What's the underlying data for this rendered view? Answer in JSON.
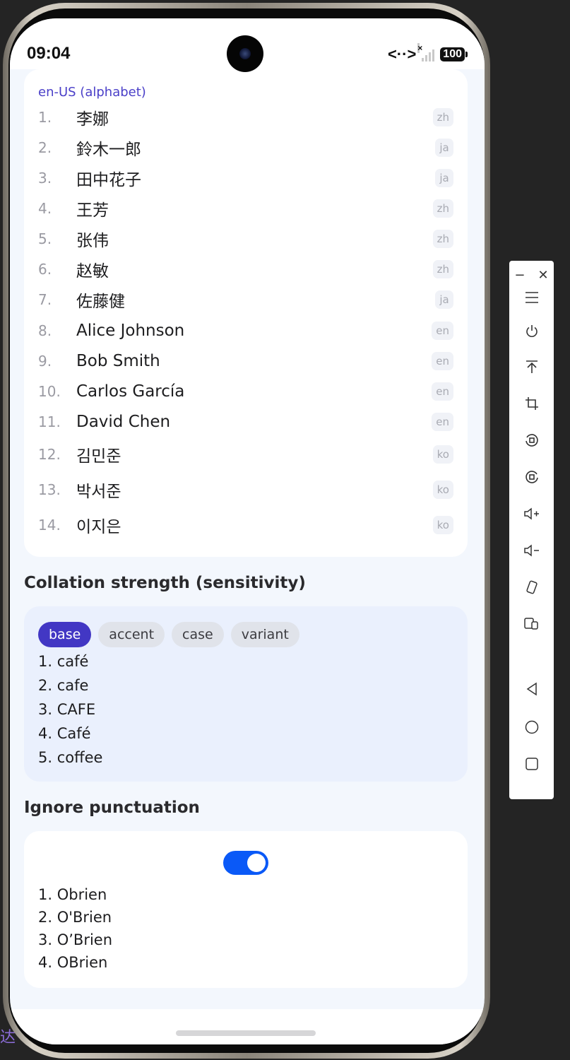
{
  "status_bar": {
    "time": "09:04",
    "battery": "100"
  },
  "sorted_list": {
    "caption": "en-US (alphabet)",
    "rows": [
      {
        "num": "1.",
        "name": "李娜",
        "lang": "zh"
      },
      {
        "num": "2.",
        "name": "鈴木一郎",
        "lang": "ja"
      },
      {
        "num": "3.",
        "name": "田中花子",
        "lang": "ja"
      },
      {
        "num": "4.",
        "name": "王芳",
        "lang": "zh"
      },
      {
        "num": "5.",
        "name": "张伟",
        "lang": "zh"
      },
      {
        "num": "6.",
        "name": "赵敏",
        "lang": "zh"
      },
      {
        "num": "7.",
        "name": "佐藤健",
        "lang": "ja"
      },
      {
        "num": "8.",
        "name": "Alice Johnson",
        "lang": "en"
      },
      {
        "num": "9.",
        "name": "Bob Smith",
        "lang": "en"
      },
      {
        "num": "10.",
        "name": "Carlos García",
        "lang": "en"
      },
      {
        "num": "11.",
        "name": "David Chen",
        "lang": "en"
      },
      {
        "num": "12.",
        "name": "김민준",
        "lang": "ko"
      },
      {
        "num": "13.",
        "name": "박서준",
        "lang": "ko"
      },
      {
        "num": "14.",
        "name": "이지은",
        "lang": "ko"
      }
    ]
  },
  "strength": {
    "heading": "Collation strength (sensitivity)",
    "chips": [
      "base",
      "accent",
      "case",
      "variant"
    ],
    "active_chip": "base",
    "results": [
      "1. café",
      "2. cafe",
      "3. CAFE",
      "4. Café",
      "5. coffee"
    ]
  },
  "punctuation": {
    "heading": "Ignore punctuation",
    "toggle_on": true,
    "results": [
      "1. Obrien",
      "2. O'Brien",
      "3. O’Brien",
      "4. OBrien"
    ]
  },
  "corner_glyph": "达",
  "toolbar": {
    "icons": [
      "minimize-icon",
      "close-icon",
      "menu-icon",
      "power-icon",
      "pin-top-icon",
      "crop-icon",
      "rotate-left-icon",
      "rotate-right-icon",
      "volume-up-icon",
      "volume-down-icon",
      "shake-icon",
      "multi-device-icon",
      "back-icon",
      "home-icon",
      "recents-icon"
    ]
  }
}
